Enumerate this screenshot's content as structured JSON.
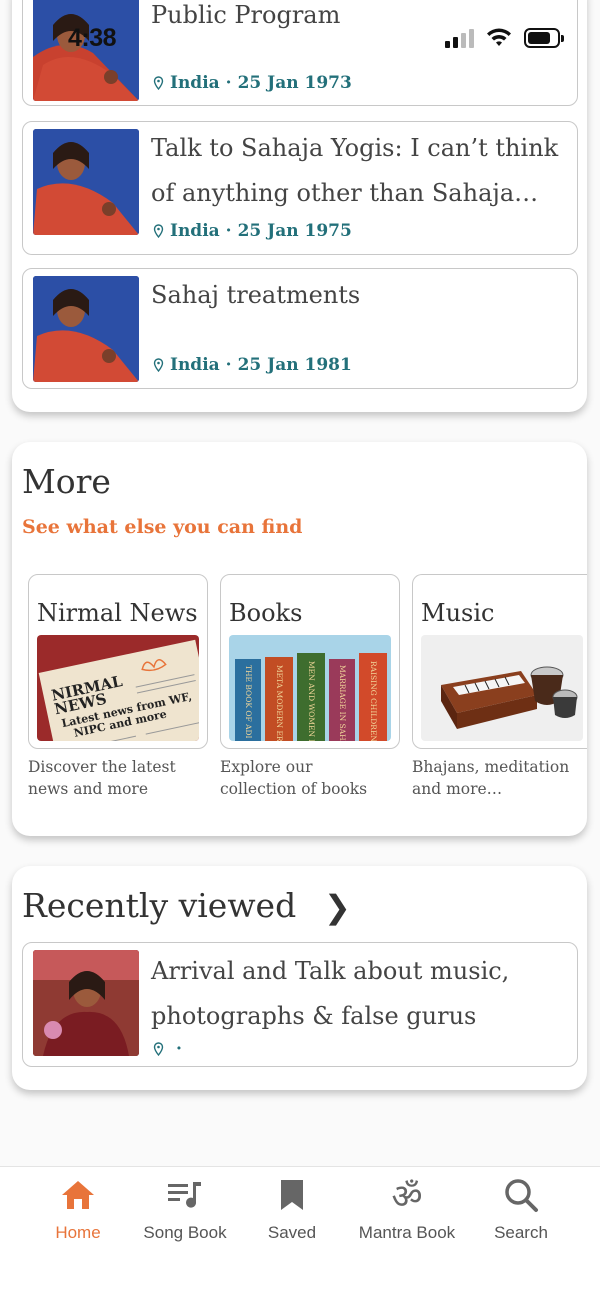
{
  "status_bar": {
    "time": "4:38"
  },
  "talks": [
    {
      "title": "Public Program",
      "location": "India",
      "date": "25 Jan 1973"
    },
    {
      "title": "Talk to Sahaja Yogis: I can’t think of anything other than Sahaja…",
      "location": "India",
      "date": "25 Jan 1975"
    },
    {
      "title": "Sahaj treatments",
      "location": "India",
      "date": "25 Jan 1981"
    }
  ],
  "separator": "·",
  "more": {
    "title": "More",
    "subtitle": "See what else you can find",
    "tiles": [
      {
        "title": "Nirmal News",
        "description": "Discover the latest news and more",
        "art_text_1": "NIRMAL",
        "art_text_2": "NEWS",
        "art_text_3": "Latest news from WF,",
        "art_text_4": "NIPC and more"
      },
      {
        "title": "Books",
        "description": "Explore our collection of books",
        "spine_1": "THE BOOK OF ADI SH",
        "spine_2": "META MODERN ERA",
        "spine_3": "MEN AND WOMEN IN",
        "spine_4": "MARRIAGE IN SAHAJA",
        "spine_5": "RAISING CHILDREN IN"
      },
      {
        "title": "Music",
        "description": "Bhajans, meditation and more…"
      }
    ]
  },
  "recent": {
    "title": "Recently viewed",
    "items": [
      {
        "title": "Arrival and Talk about music, photographs & false gurus",
        "location": "",
        "date": ""
      }
    ]
  },
  "nav": {
    "items": [
      {
        "label": "Home",
        "icon": "home-icon",
        "active": true
      },
      {
        "label": "Song Book",
        "icon": "song-book-icon",
        "active": false
      },
      {
        "label": "Saved",
        "icon": "bookmark-icon",
        "active": false
      },
      {
        "label": "Mantra Book",
        "icon": "om-icon",
        "active": false
      },
      {
        "label": "Search",
        "icon": "search-icon",
        "active": false
      }
    ]
  },
  "colors": {
    "accent": "#e8743a",
    "meta": "#23707a"
  }
}
